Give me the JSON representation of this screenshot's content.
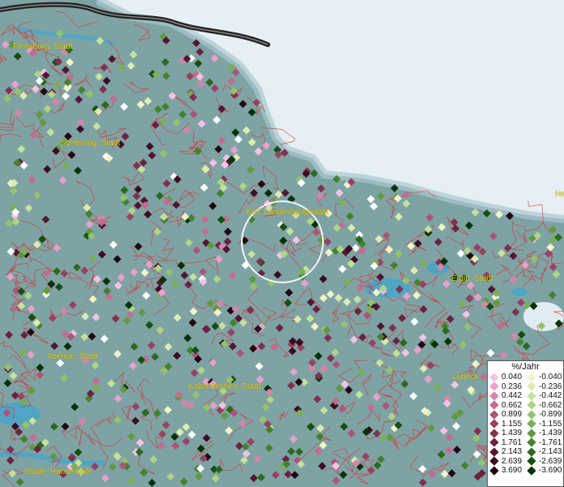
{
  "map": {
    "cities": [
      {
        "name": "Flensburg, Stadt"
      },
      {
        "name": "Schleswig, Stadt"
      },
      {
        "name": "Kiel, Landeshauptstadt"
      },
      {
        "name": "Eutin, Stadt"
      },
      {
        "name": "Itzehoe, Stadt"
      },
      {
        "name": "Kaltenkirchen, Stadt"
      },
      {
        "name": "Lübeck"
      },
      {
        "name": "Stade, Hansestadt"
      },
      {
        "name": "He"
      }
    ],
    "colors": {
      "sea": "#e6f0f4",
      "land": "#7ea3a5",
      "lake": "#4aa5c8",
      "borders": "#e02a2a",
      "city_label": "#f0d000"
    }
  },
  "legend": {
    "title": "%/Jahr",
    "rows": [
      {
        "pos": "0.040",
        "neg": "-0.040",
        "pos_color": "#f6c2e4",
        "neg_color": "#f2f3c6"
      },
      {
        "pos": "0.236",
        "neg": "-0.236",
        "pos_color": "#e9a0cb",
        "neg_color": "#dcecb0"
      },
      {
        "pos": "0.442",
        "neg": "-0.442",
        "pos_color": "#d585ac",
        "neg_color": "#c6e19a"
      },
      {
        "pos": "0.662",
        "neg": "-0.662",
        "pos_color": "#c26c92",
        "neg_color": "#afd485"
      },
      {
        "pos": "0.899",
        "neg": "-0.899",
        "pos_color": "#ad5479",
        "neg_color": "#94c36c"
      },
      {
        "pos": "1.155",
        "neg": "-1.155",
        "pos_color": "#994163",
        "neg_color": "#7ab055"
      },
      {
        "pos": "1.439",
        "neg": "-1.439",
        "pos_color": "#823050",
        "neg_color": "#5f9a40"
      },
      {
        "pos": "1.761",
        "neg": "-1.761",
        "pos_color": "#6b2240",
        "neg_color": "#44822d"
      },
      {
        "pos": "2.143",
        "neg": "-2.143",
        "pos_color": "#531630",
        "neg_color": "#2c691d"
      },
      {
        "pos": "2.639",
        "neg": "-2.639",
        "pos_color": "#3c0c21",
        "neg_color": "#164f10"
      },
      {
        "pos": "3.690",
        "neg": "-3.690",
        "pos_color": "#230512",
        "neg_color": "#053305"
      }
    ]
  }
}
